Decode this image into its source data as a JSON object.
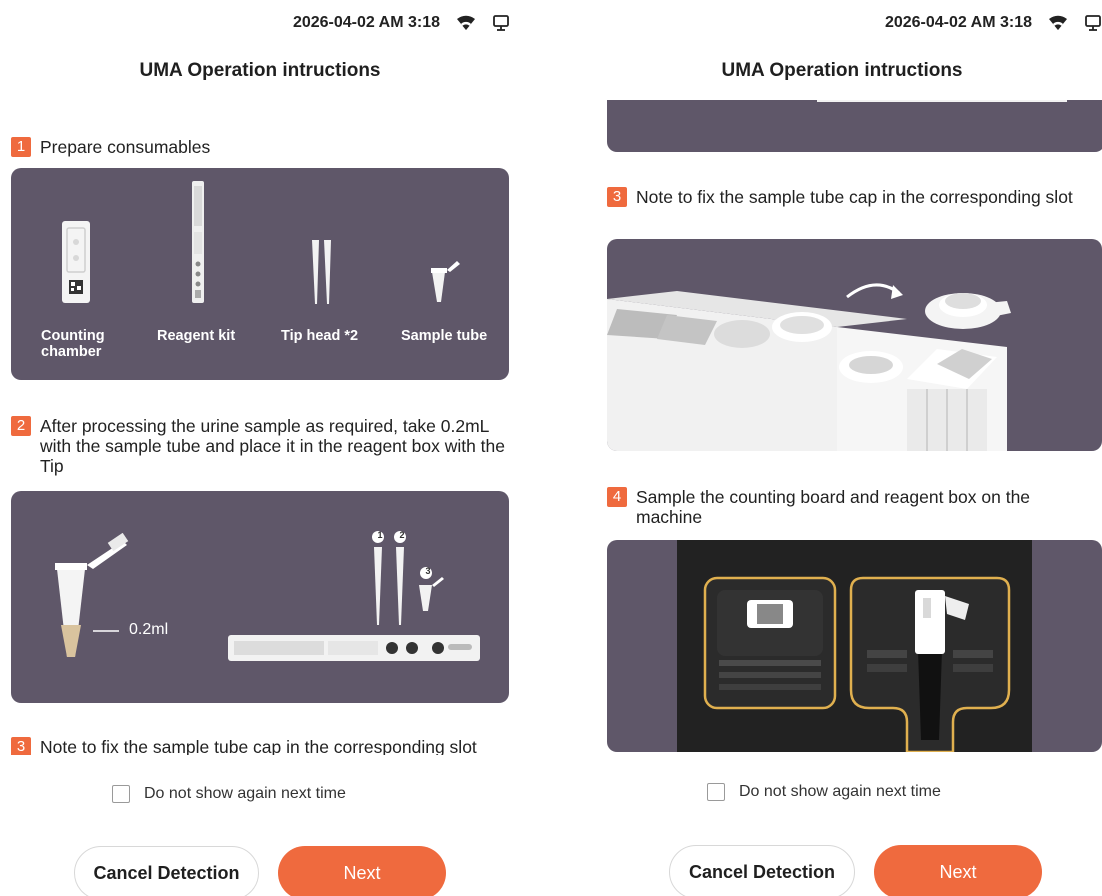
{
  "status_bar": {
    "datetime": "2026-04-02 AM 3:18",
    "wifi_icon": "wifi-icon",
    "device_icon": "monitor-icon"
  },
  "title": "UMA Operation intructions",
  "steps": [
    {
      "number": "1",
      "text": "Prepare consumables"
    },
    {
      "number": "2",
      "text": "After processing the urine sample as required, take 0.2mL with the sample tube and place it in the reagent box with the Tip"
    },
    {
      "number": "3",
      "text": "Note to fix the sample tube cap in the corresponding slot"
    },
    {
      "number": "4",
      "text": "Sample the counting board and reagent box on the machine"
    }
  ],
  "consumables": [
    {
      "label": "Counting chamber"
    },
    {
      "label": "Reagent kit"
    },
    {
      "label": "Tip head *2"
    },
    {
      "label": "Sample tube"
    }
  ],
  "step2_volume_label": "0.2ml",
  "step2_markers": [
    "1",
    "2",
    "3"
  ],
  "checkbox_label": "Do not show again next time",
  "checkbox_checked": false,
  "buttons": {
    "cancel": "Cancel Detection",
    "next": "Next"
  },
  "colors": {
    "accent": "#ef6a3e",
    "card_bg": "#5f5769"
  }
}
